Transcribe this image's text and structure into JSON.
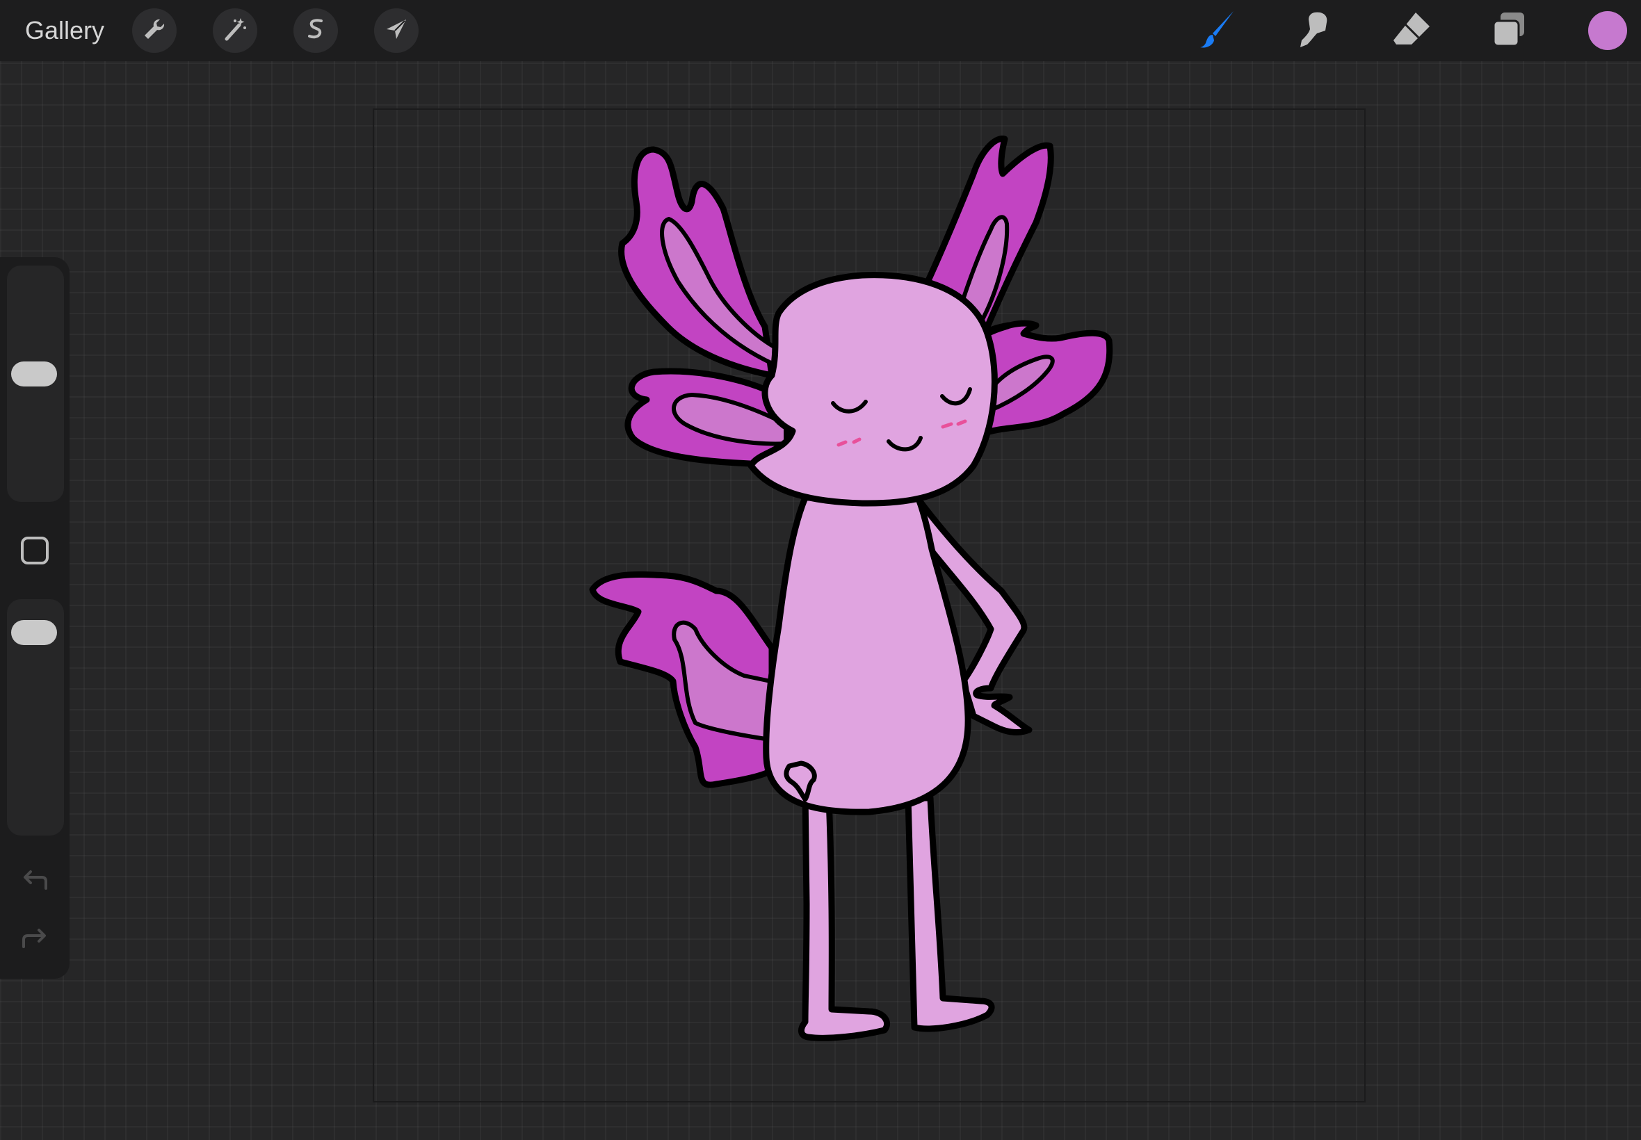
{
  "topbar": {
    "gallery_label": "Gallery",
    "left_tools": [
      {
        "name": "actions",
        "icon": "wrench-icon"
      },
      {
        "name": "adjustments",
        "icon": "magic-wand-icon"
      },
      {
        "name": "selection",
        "icon": "selection-s-icon"
      },
      {
        "name": "transform",
        "icon": "arrow-cursor-icon"
      }
    ],
    "right_tools": [
      {
        "name": "brush",
        "icon": "brush-icon",
        "active": true,
        "active_color": "#1a7cf5"
      },
      {
        "name": "smudge",
        "icon": "smudge-finger-icon"
      },
      {
        "name": "eraser",
        "icon": "eraser-icon"
      },
      {
        "name": "layers",
        "icon": "layers-icon"
      }
    ],
    "current_color": "#c679cf"
  },
  "sidebar": {
    "brush_size_level": 0.55,
    "opacity_level": 0.93,
    "modify_icon": "square-outline-icon",
    "undo_icon": "undo-icon",
    "redo_icon": "redo-icon"
  },
  "artwork": {
    "subject": "axolotl",
    "colors": {
      "body": "#e0a4e0",
      "gills": "#c244c2",
      "gill_inner": "#cc77cc",
      "blush": "#e8509a",
      "outline": "#000000"
    }
  }
}
